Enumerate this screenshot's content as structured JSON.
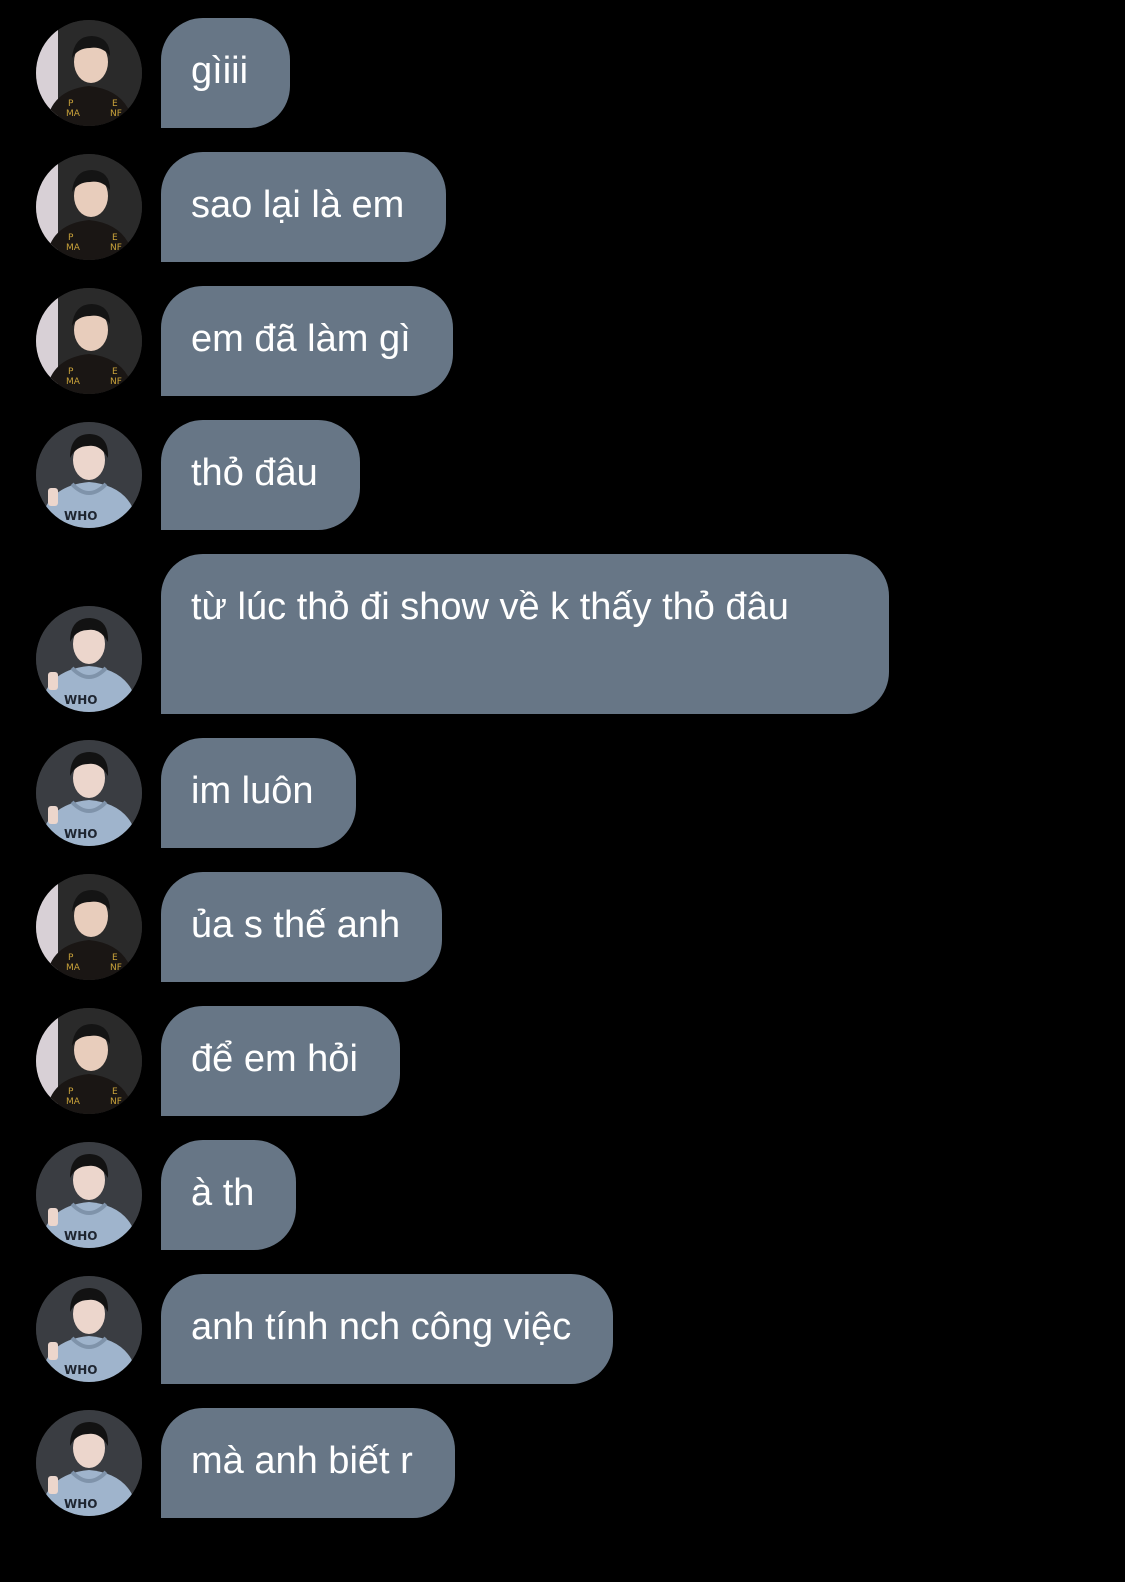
{
  "colors": {
    "background": "#000000",
    "bubble": "#677686",
    "text": "#ffffff"
  },
  "messages": [
    {
      "avatar": "avatar-a",
      "text": "gìiii"
    },
    {
      "avatar": "avatar-a",
      "text": "sao lại là em"
    },
    {
      "avatar": "avatar-a",
      "text": "em đã làm gì"
    },
    {
      "avatar": "avatar-b",
      "text": "thỏ đâu"
    },
    {
      "avatar": "avatar-b",
      "text": "từ lúc thỏ đi show về k thấy thỏ đâu"
    },
    {
      "avatar": "avatar-b",
      "text": "im luôn"
    },
    {
      "avatar": "avatar-a",
      "text": "ủa s thế anh"
    },
    {
      "avatar": "avatar-a",
      "text": "để em hỏi"
    },
    {
      "avatar": "avatar-b",
      "text": "à th"
    },
    {
      "avatar": "avatar-b",
      "text": "anh tính nch công việc"
    },
    {
      "avatar": "avatar-b",
      "text": "mà anh biết r"
    }
  ]
}
